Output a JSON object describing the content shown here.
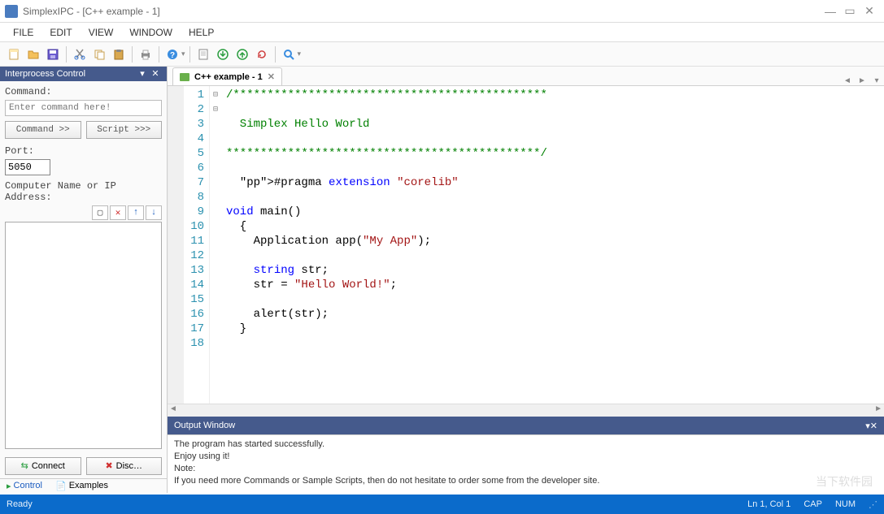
{
  "window": {
    "title": "SimplexIPC - [C++ example - 1]"
  },
  "menu": {
    "items": [
      "FILE",
      "EDIT",
      "VIEW",
      "WINDOW",
      "HELP"
    ]
  },
  "toolbar": {
    "group1": [
      "new-file",
      "open-folder",
      "save"
    ],
    "group2": [
      "cut",
      "copy",
      "paste"
    ],
    "group3": [
      "print"
    ],
    "group4": [
      "help"
    ],
    "group5": [
      "document",
      "down-green",
      "up-green",
      "refresh"
    ],
    "group6": [
      "search"
    ]
  },
  "sidebar": {
    "title": "Interprocess Control",
    "command_label": "Command:",
    "command_placeholder": "Enter command here!",
    "btn_command": "Command >>",
    "btn_script": "Script >>>",
    "port_label": "Port:",
    "port_value": "5050",
    "ip_label": "Computer Name or IP Address:",
    "btn_connect": "Connect",
    "btn_disconnect": "Disc…",
    "tabs": {
      "control": "Control",
      "examples": "Examples"
    }
  },
  "editor": {
    "tab_label": "C++ example - 1",
    "lines": [
      {
        "n": 1,
        "t": "cm",
        "s": "/**********************************************"
      },
      {
        "n": 2,
        "t": "cm",
        "s": ""
      },
      {
        "n": 3,
        "t": "cm",
        "s": "  Simplex Hello World"
      },
      {
        "n": 4,
        "t": "cm",
        "s": ""
      },
      {
        "n": 5,
        "t": "cm",
        "s": "**********************************************/"
      },
      {
        "n": 6,
        "t": "",
        "s": ""
      },
      {
        "n": 7,
        "t": "pp",
        "s": "  #pragma extension \"corelib\""
      },
      {
        "n": 8,
        "t": "",
        "s": ""
      },
      {
        "n": 9,
        "t": "kw",
        "s": "void main()"
      },
      {
        "n": 10,
        "t": "",
        "s": "  {"
      },
      {
        "n": 11,
        "t": "",
        "s": "    Application app(\"My App\");"
      },
      {
        "n": 12,
        "t": "",
        "s": ""
      },
      {
        "n": 13,
        "t": "",
        "s": "    string str;"
      },
      {
        "n": 14,
        "t": "",
        "s": "    str = \"Hello World!\";"
      },
      {
        "n": 15,
        "t": "",
        "s": ""
      },
      {
        "n": 16,
        "t": "",
        "s": "    alert(str);"
      },
      {
        "n": 17,
        "t": "",
        "s": "  }"
      },
      {
        "n": 18,
        "t": "",
        "s": ""
      }
    ]
  },
  "output": {
    "title": "Output Window",
    "lines": [
      "The program has started successfully.",
      "Enjoy using it!",
      "",
      "Note:",
      "If you need more Commands or Sample Scripts, then do not hesitate to order some from the developer site."
    ]
  },
  "status": {
    "ready": "Ready",
    "pos": "Ln 1, Col 1",
    "cap": "CAP",
    "num": "NUM"
  },
  "watermark": "当下软件园"
}
